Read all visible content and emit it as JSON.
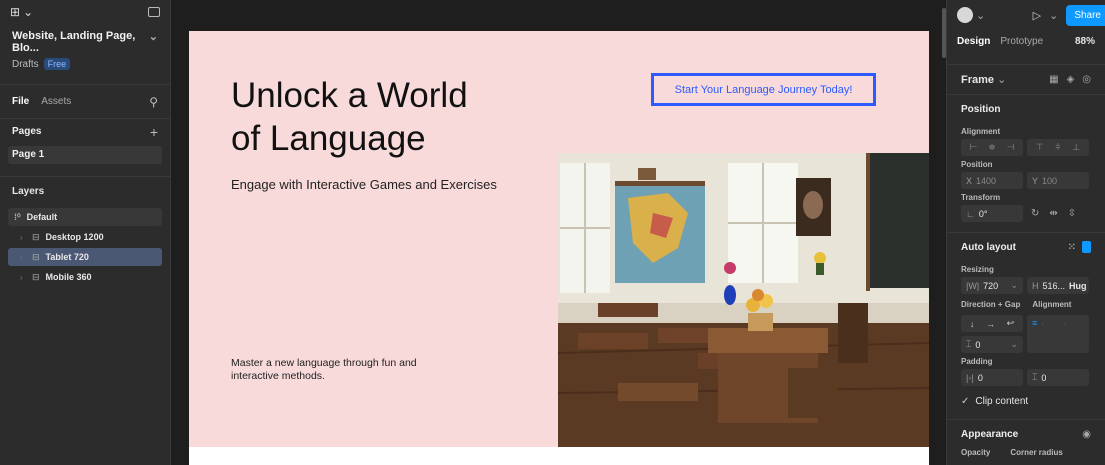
{
  "left": {
    "logo_symbol": "⊞",
    "project_title": "Website, Landing Page, Blo...",
    "project_location": "Drafts",
    "plan_badge": "Free",
    "tabs": {
      "file": "File",
      "assets": "Assets"
    },
    "pages_heading": "Pages",
    "pages": [
      "Page 1"
    ],
    "layers_heading": "Layers",
    "layers": {
      "group": "Default",
      "items": [
        "Desktop 1200",
        "Tablet 720",
        "Mobile 360"
      ]
    }
  },
  "canvas": {
    "headline_line1": "Unlock a World",
    "headline_line2": "of Language",
    "subheadline": "Engage with Interactive Games and Exercises",
    "body": "Master a new language through fun and interactive methods.",
    "cta": "Start Your Language Journey Today!"
  },
  "right": {
    "share": "Share",
    "tabs": {
      "design": "Design",
      "prototype": "Prototype"
    },
    "zoom": "88%",
    "frame_label": "Frame",
    "position_heading": "Position",
    "alignment_label": "Alignment",
    "position_label": "Position",
    "x_key": "X",
    "x_value": "1400",
    "y_key": "Y",
    "y_value": "100",
    "transform_label": "Transform",
    "rotation": "0°",
    "auto_layout_heading": "Auto layout",
    "resizing_label": "Resizing",
    "w_key": "|W|",
    "w_value": "720",
    "h_key": "H",
    "h_value": "516...",
    "h_mode": "Hug",
    "direction_label": "Direction + Gap",
    "alignment2_label": "Alignment",
    "gap_value": "0",
    "padding_label": "Padding",
    "pad_h": "0",
    "pad_v": "0",
    "clip_content": "Clip content",
    "appearance_heading": "Appearance",
    "opacity_label": "Opacity",
    "corner_radius_label": "Corner radius"
  },
  "colors": {
    "frame_bg": "#f8dadb",
    "cta_blue": "#2d5bff",
    "share_blue": "#0d99ff",
    "selected_layer": "#4a5873"
  }
}
